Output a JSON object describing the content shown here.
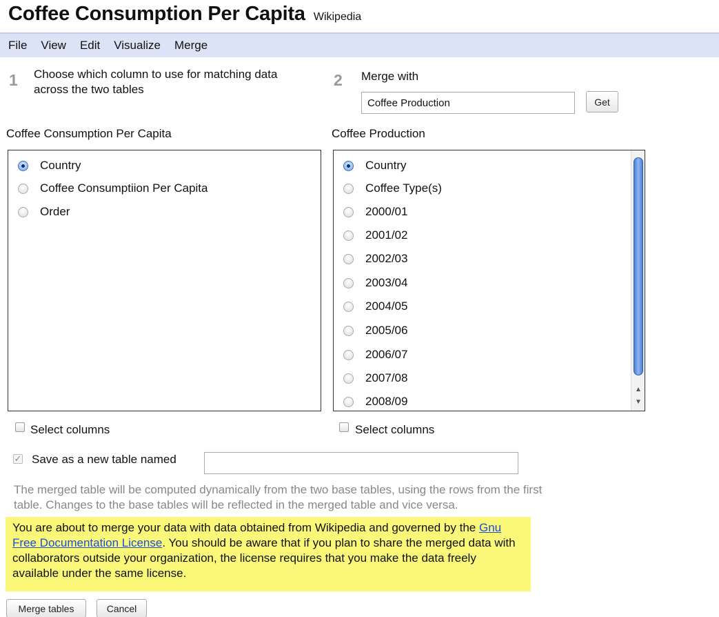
{
  "header": {
    "title": "Coffee Consumption Per Capita",
    "source": "Wikipedia"
  },
  "menu": [
    "File",
    "View",
    "Edit",
    "Visualize",
    "Merge"
  ],
  "step1": {
    "number": "1",
    "text_line1": "Choose which column to use for matching data",
    "text_line2": "across the two tables"
  },
  "step2": {
    "number": "2",
    "label": "Merge with",
    "input_value": "Coffee Production",
    "get_button": "Get"
  },
  "left_table": {
    "heading": "Coffee Consumption Per Capita",
    "options": [
      "Country",
      "Coffee Consumptiion Per Capita",
      "Order"
    ],
    "selected": "Country",
    "select_columns_label": "Select columns"
  },
  "right_table": {
    "heading": "Coffee Production",
    "options": [
      "Country",
      "Coffee Type(s)",
      "2000/01",
      "2001/02",
      "2002/03",
      "2003/04",
      "2004/05",
      "2005/06",
      "2006/07",
      "2007/08",
      "2008/09"
    ],
    "selected": "Country",
    "select_columns_label": "Select columns"
  },
  "save": {
    "label": "Save as a new table named",
    "value": ""
  },
  "info": {
    "line1": "The merged table will be computed dynamically from the two base tables, using the rows from the first",
    "line2": "table. Changes to the base tables will be reflected in the merged table and vice versa."
  },
  "warning": {
    "before_link": "You are about to merge your data with data obtained from Wikipedia and governed by the ",
    "link_text": "Gnu Free Documentation License",
    "after_link": ". You should be aware that if you plan to share the merged data with collaborators outside your organization, the license requires that you make the data freely available under the same license."
  },
  "buttons": {
    "merge": "Merge tables",
    "cancel": "Cancel"
  }
}
